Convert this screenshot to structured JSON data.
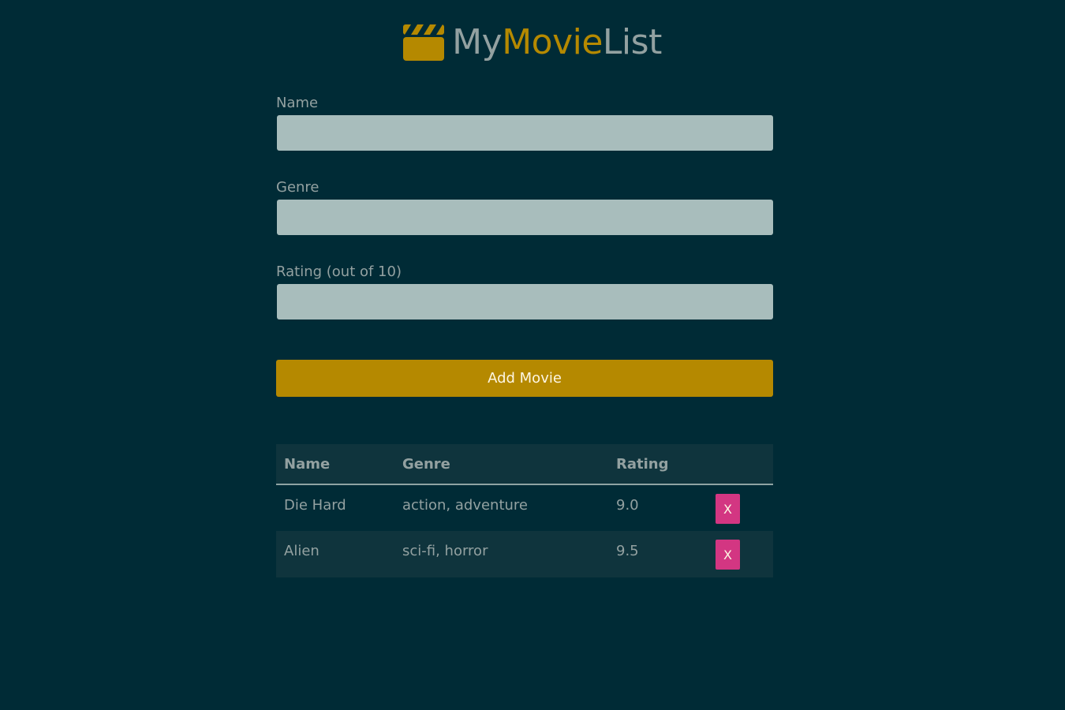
{
  "header": {
    "icon": "clapperboard-icon",
    "title_part1": "My",
    "title_part2": "Movie",
    "title_part3": "List"
  },
  "form": {
    "name_label": "Name",
    "name_value": "",
    "genre_label": "Genre",
    "genre_value": "",
    "rating_label": "Rating (out of 10)",
    "rating_value": "",
    "add_button_label": "Add Movie"
  },
  "table": {
    "headers": [
      "Name",
      "Genre",
      "Rating",
      ""
    ],
    "rows": [
      {
        "name": "Die Hard",
        "genre": "action, adventure",
        "rating": "9.0",
        "delete_label": "X"
      },
      {
        "name": "Alien",
        "genre": "sci-fi, horror",
        "rating": "9.5",
        "delete_label": "X"
      }
    ]
  },
  "colors": {
    "background": "#002b36",
    "accent": "#b58900",
    "delete": "#d33682",
    "text": "#93a1a1",
    "input": "#a8bdbc"
  }
}
